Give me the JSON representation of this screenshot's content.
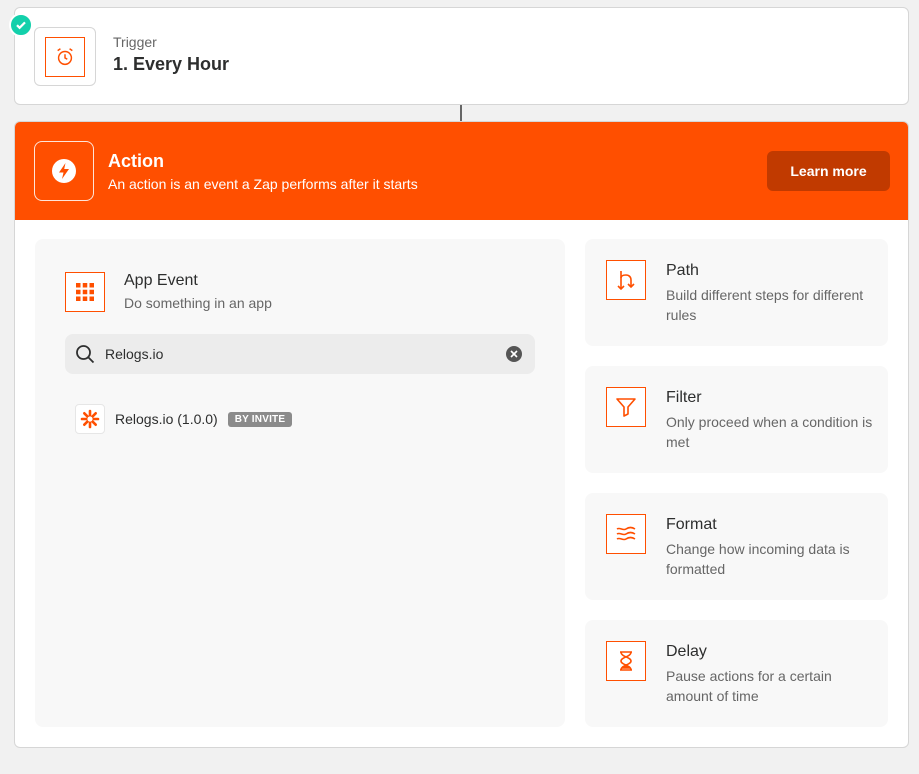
{
  "trigger": {
    "label": "Trigger",
    "title": "1. Every Hour",
    "icon": "alarm-clock-icon",
    "status_icon": "check-icon"
  },
  "action": {
    "title": "Action",
    "subtitle": "An action is an event a Zap performs after it starts",
    "icon": "lightning-bolt-icon",
    "learn_more_label": "Learn more",
    "accent_color": "#ff4f00"
  },
  "app_event": {
    "title": "App Event",
    "subtitle": "Do something in an app",
    "icon": "grid-icon",
    "search": {
      "value": "Relogs.io",
      "placeholder": ""
    },
    "results": [
      {
        "name": "Relogs.io (1.0.0)",
        "badge": "BY INVITE",
        "icon": "zapier-asterisk-icon"
      }
    ]
  },
  "tools": [
    {
      "title": "Path",
      "description": "Build different steps for different rules",
      "icon": "path-branch-icon"
    },
    {
      "title": "Filter",
      "description": "Only proceed when a condition is met",
      "icon": "filter-funnel-icon"
    },
    {
      "title": "Format",
      "description": "Change how incoming data is formatted",
      "icon": "format-waves-icon"
    },
    {
      "title": "Delay",
      "description": "Pause actions for a certain amount of time",
      "icon": "hourglass-icon"
    }
  ]
}
